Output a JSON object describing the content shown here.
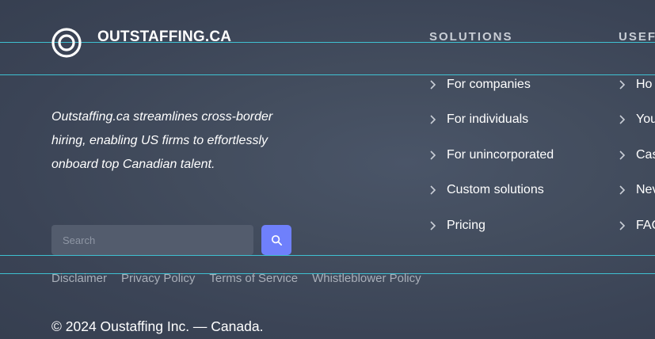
{
  "brand": {
    "name": "OUTSTAFFING.CA",
    "logo_icon": "concentric-ring-logo-icon"
  },
  "tagline": "Outstaffing.ca streamlines cross-border hiring, enabling US firms to effortlessly onboard top Canadian talent.",
  "search": {
    "placeholder": "Search",
    "value": "",
    "button_icon": "search-icon",
    "button_color": "#6f80fb"
  },
  "columns": {
    "solutions": {
      "heading": "SOLUTIONS",
      "items": [
        {
          "label": "For companies",
          "icon": "chevron-right-icon"
        },
        {
          "label": "For individuals",
          "icon": "chevron-right-icon"
        },
        {
          "label": "For unincorporated",
          "icon": "chevron-right-icon"
        },
        {
          "label": "Custom solutions",
          "icon": "chevron-right-icon"
        },
        {
          "label": "Pricing",
          "icon": "chevron-right-icon"
        }
      ]
    },
    "useful": {
      "heading": "USEF",
      "items": [
        {
          "label": "Ho",
          "icon": "chevron-right-icon"
        },
        {
          "label": "You",
          "icon": "chevron-right-icon"
        },
        {
          "label": "Cas",
          "icon": "chevron-right-icon"
        },
        {
          "label": "Nev",
          "icon": "chevron-right-icon"
        },
        {
          "label": "FAQ",
          "icon": "chevron-right-icon"
        }
      ]
    }
  },
  "legal_links": [
    "Disclaimer",
    "Privacy Policy",
    "Terms of Service",
    "Whistleblower Policy"
  ],
  "copyright": "© 2024 Oustaffing Inc. — Canada.",
  "colors": {
    "background": "#3f4859",
    "accent": "#6f80fb",
    "guide_line": "#3fd6e6",
    "heading": "#c9ced6",
    "muted_link": "#a9afb9"
  }
}
